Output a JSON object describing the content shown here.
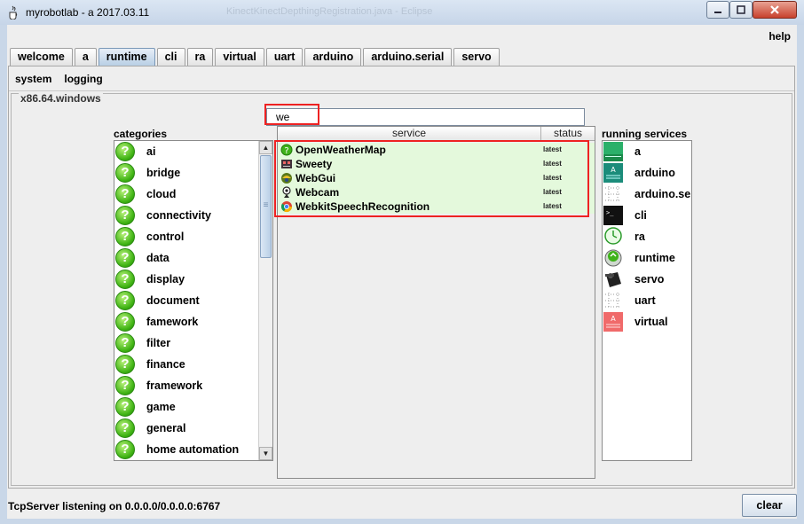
{
  "window": {
    "title": "myrobotlab - a 2017.03.11",
    "ghost_title": "KinectKinectDepthingRegistration.java - Eclipse",
    "icons": {
      "app": "java-cup-icon",
      "minimize": "minimize-icon",
      "maximize": "maximize-icon",
      "close": "close-icon"
    }
  },
  "menu": {
    "help": "help"
  },
  "tabs": [
    {
      "label": "welcome"
    },
    {
      "label": "a"
    },
    {
      "label": "runtime",
      "active": true
    },
    {
      "label": "cli"
    },
    {
      "label": "ra"
    },
    {
      "label": "virtual"
    },
    {
      "label": "uart"
    },
    {
      "label": "arduino"
    },
    {
      "label": "arduino.serial"
    },
    {
      "label": "servo"
    }
  ],
  "subtabs": [
    {
      "label": "system"
    },
    {
      "label": "logging"
    }
  ],
  "platform": "x86.64.windows",
  "search": {
    "value": "we"
  },
  "categories": {
    "title": "categories",
    "items": [
      "ai",
      "bridge",
      "cloud",
      "connectivity",
      "control",
      "data",
      "display",
      "document",
      "famework",
      "filter",
      "finance",
      "framework",
      "game",
      "general",
      "home automation"
    ]
  },
  "services": {
    "headers": {
      "service": "service",
      "status": "status"
    },
    "rows": [
      {
        "name": "OpenWeatherMap",
        "status": "latest",
        "icon": "weather-icon"
      },
      {
        "name": "Sweety",
        "status": "latest",
        "icon": "sweety-robot-icon"
      },
      {
        "name": "WebGui",
        "status": "latest",
        "icon": "webgui-icon"
      },
      {
        "name": "Webcam",
        "status": "latest",
        "icon": "webcam-icon"
      },
      {
        "name": "WebkitSpeechRecognition",
        "status": "latest",
        "icon": "chrome-icon"
      }
    ]
  },
  "running": {
    "title": "running services",
    "items": [
      {
        "label": "a",
        "icon": "green-panel-icon"
      },
      {
        "label": "arduino",
        "icon": "arduino-board-icon"
      },
      {
        "label": "arduino.serial",
        "icon": "serial-port-icon"
      },
      {
        "label": "cli",
        "icon": "terminal-icon"
      },
      {
        "label": "ra",
        "icon": "clock-icon"
      },
      {
        "label": "runtime",
        "icon": "runtime-icon"
      },
      {
        "label": "servo",
        "icon": "servo-icon"
      },
      {
        "label": "uart",
        "icon": "uart-icon"
      },
      {
        "label": "virtual",
        "icon": "virtual-board-icon"
      }
    ]
  },
  "status": {
    "text": "TcpServer listening on 0.0.0.0/0.0.0.0:6767",
    "clear_label": "clear"
  }
}
